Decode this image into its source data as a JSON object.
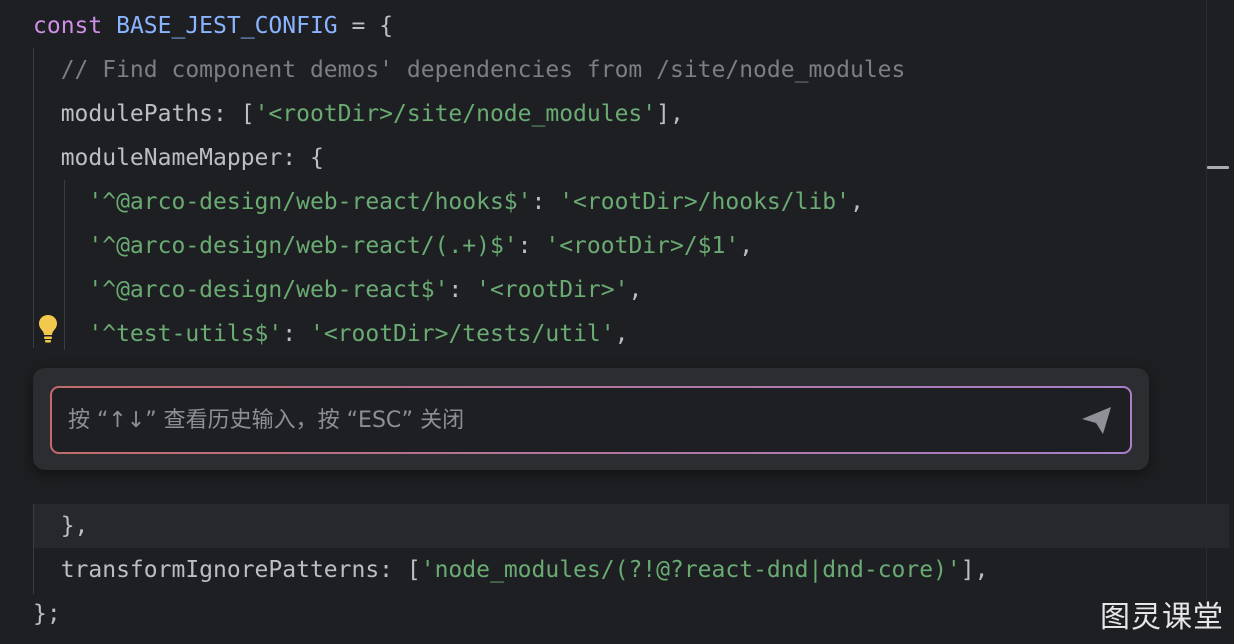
{
  "editor": {
    "lines": [
      {
        "tokens": [
          {
            "t": "const ",
            "c": "kw"
          },
          {
            "t": "BASE_JEST_CONFIG",
            "c": "const"
          },
          {
            "t": " = {",
            "c": "plain"
          }
        ]
      },
      {
        "tokens": [
          {
            "t": "  // Find component demos' dependencies from /site/node_modules",
            "c": "comment"
          }
        ]
      },
      {
        "tokens": [
          {
            "t": "  modulePaths: [",
            "c": "plain"
          },
          {
            "t": "'<rootDir>/site/node_modules'",
            "c": "str"
          },
          {
            "t": "],",
            "c": "plain"
          }
        ]
      },
      {
        "tokens": [
          {
            "t": "  moduleNameMapper: {",
            "c": "plain"
          }
        ]
      },
      {
        "tokens": [
          {
            "t": "    ",
            "c": "plain"
          },
          {
            "t": "'^@arco-design/web-react/hooks$'",
            "c": "str"
          },
          {
            "t": ": ",
            "c": "plain"
          },
          {
            "t": "'<rootDir>/hooks/lib'",
            "c": "str"
          },
          {
            "t": ",",
            "c": "plain"
          }
        ]
      },
      {
        "tokens": [
          {
            "t": "    ",
            "c": "plain"
          },
          {
            "t": "'^@arco-design/web-react/(.+)$'",
            "c": "str"
          },
          {
            "t": ": ",
            "c": "plain"
          },
          {
            "t": "'<rootDir>/$1'",
            "c": "str"
          },
          {
            "t": ",",
            "c": "plain"
          }
        ]
      },
      {
        "tokens": [
          {
            "t": "    ",
            "c": "plain"
          },
          {
            "t": "'^@arco-design/web-react$'",
            "c": "str"
          },
          {
            "t": ": ",
            "c": "plain"
          },
          {
            "t": "'<rootDir>'",
            "c": "str"
          },
          {
            "t": ",",
            "c": "plain"
          }
        ]
      },
      {
        "tokens": [
          {
            "t": "    ",
            "c": "plain"
          },
          {
            "t": "'^test-utils$'",
            "c": "str"
          },
          {
            "t": ": ",
            "c": "plain"
          },
          {
            "t": "'<rootDir>/tests/util'",
            "c": "str"
          },
          {
            "t": ",",
            "c": "plain"
          }
        ]
      },
      {
        "tokens": [
          {
            "t": "  },",
            "c": "plain"
          }
        ]
      },
      {
        "tokens": [
          {
            "t": "  transformIgnorePatterns: [",
            "c": "plain"
          },
          {
            "t": "'node_modules/(?!@?react-dnd|dnd-core)'",
            "c": "str"
          },
          {
            "t": "],",
            "c": "plain"
          }
        ]
      },
      {
        "tokens": [
          {
            "t": "};",
            "c": "plain"
          }
        ]
      }
    ]
  },
  "chat": {
    "placeholder": "按 “↑↓” 查看历史输入，按 “ESC” 关闭",
    "value": ""
  },
  "icons": {
    "bulb": "lightbulb-icon",
    "send": "send-icon"
  },
  "watermark": "图灵课堂",
  "colors": {
    "background": "#1e1f22",
    "keyword": "#cf8ee8",
    "constant": "#8ab4ff",
    "string": "#6aab73",
    "comment": "#7a7e85",
    "text": "#bcbec4",
    "bulb": "#f2c94c",
    "input_border_start": "#c36b6b",
    "input_border_end": "#a780c8"
  }
}
